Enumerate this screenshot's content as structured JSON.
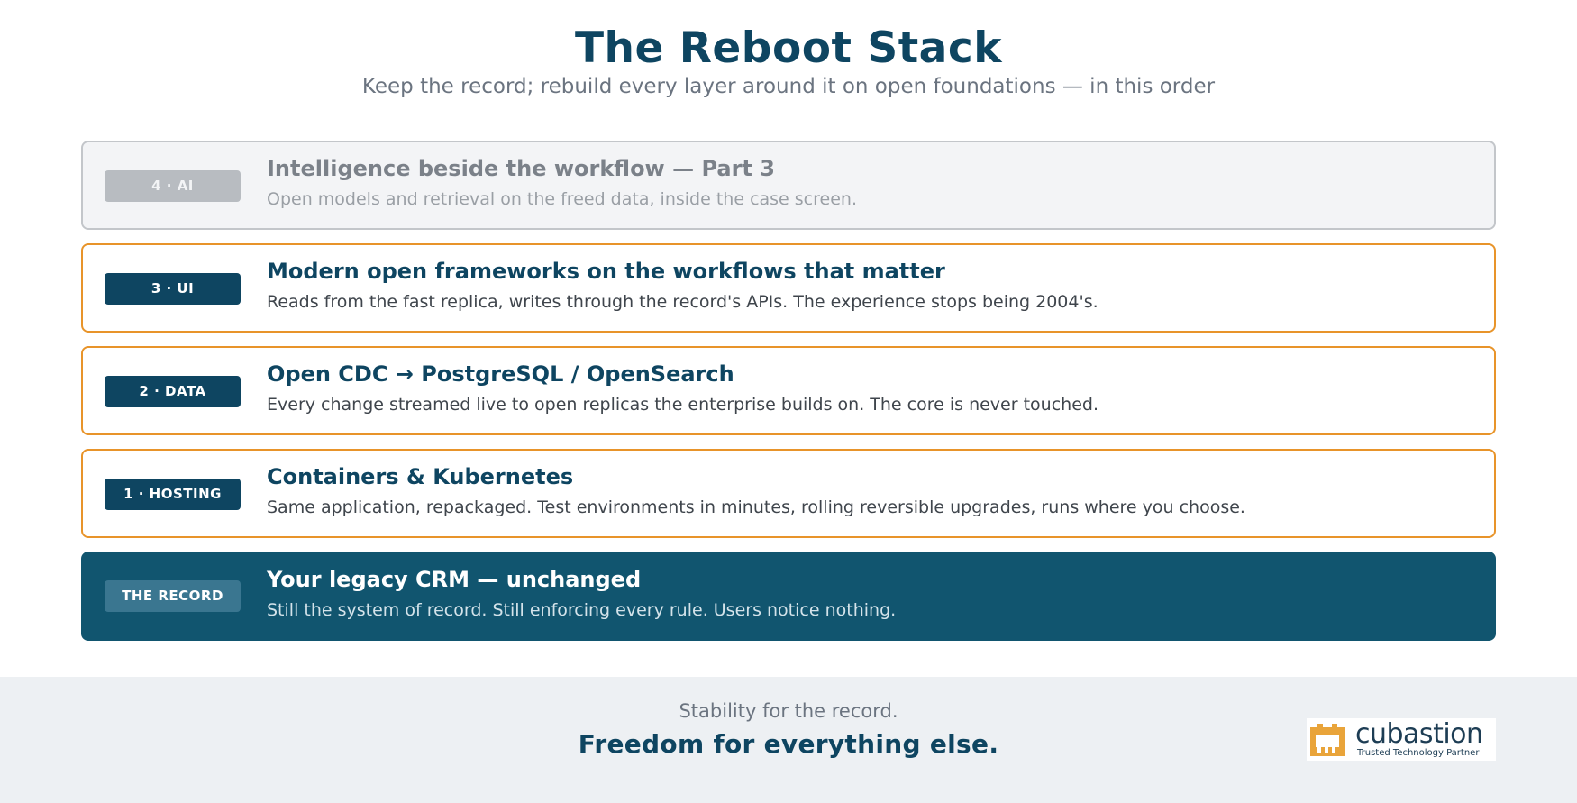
{
  "header": {
    "title": "The Reboot Stack",
    "subtitle": "Keep the record; rebuild every layer around it on open foundations — in this order"
  },
  "layers": [
    {
      "badge": "4 · AI",
      "title": "Intelligence beside the workflow — Part 3",
      "description": "Open models and retrieval on the freed data, inside the case screen."
    },
    {
      "badge": "3 · UI",
      "title": "Modern open frameworks on the workflows that matter",
      "description": "Reads from the fast replica, writes through the record's APIs. The experience stops being 2004's."
    },
    {
      "badge": "2 · DATA",
      "title": "Open CDC → PostgreSQL / OpenSearch",
      "description": "Every change streamed live to open replicas the enterprise builds on. The core is never touched."
    },
    {
      "badge": "1 · HOSTING",
      "title": "Containers & Kubernetes",
      "description": "Same application, repackaged. Test environments in minutes, rolling reversible upgrades, runs where you choose."
    },
    {
      "badge": "THE RECORD",
      "title": "Your legacy CRM — unchanged",
      "description": "Still the system of record. Still enforcing every rule. Users notice nothing."
    }
  ],
  "footer": {
    "line1": "Stability for the record.",
    "line2": "Freedom for everything else."
  },
  "logo": {
    "name": "cubastion",
    "tagline": "Trusted Technology Partner",
    "icon": "cubastion-castle-icon"
  },
  "colors": {
    "navy": "#0e4561",
    "accent_orange": "#e8942a",
    "record_fill": "#11556f",
    "muted_gray": "#c3c6ca",
    "footer_bg": "#edf0f3",
    "logo_gold": "#e9a43a"
  }
}
